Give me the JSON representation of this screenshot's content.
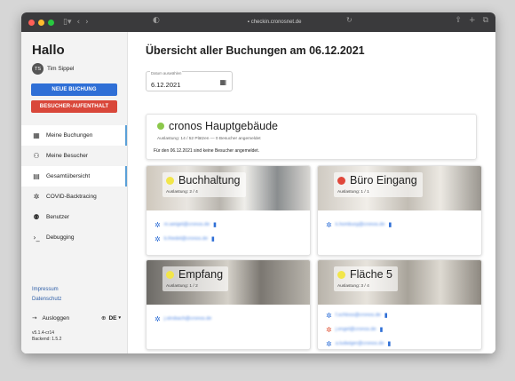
{
  "browser": {
    "url": "checkin.cronosnet.de",
    "traffic_colors": [
      "#ff5f57",
      "#febc2e",
      "#28c840"
    ]
  },
  "sidebar": {
    "greeting": "Hallo",
    "user": {
      "initials": "TS",
      "name": "Tim Sippel"
    },
    "new_booking": "NEUE BUCHUNG",
    "visitor_stay": "BESUCHER-AUFENTHALT",
    "items": [
      {
        "label": "Meine Buchungen",
        "icon": "calendar-icon",
        "active": true
      },
      {
        "label": "Meine Besucher",
        "icon": "visitors-icon",
        "active": false
      },
      {
        "label": "Gesamtübersicht",
        "icon": "overview-icon",
        "active": true
      },
      {
        "label": "COVID-Backtracing",
        "icon": "virus-icon",
        "active": false
      },
      {
        "label": "Benutzer",
        "icon": "users-icon",
        "active": false
      },
      {
        "label": "Debugging",
        "icon": "terminal-icon",
        "active": false
      }
    ],
    "impressum": "Impressum",
    "datenschutz": "Datenschutz",
    "logout": "Ausloggen",
    "language": "DE",
    "version": "v5.1.4-cr14",
    "backend": "Backend: 1.5.2"
  },
  "main": {
    "title": "Übersicht aller Buchungen am 06.12.2021",
    "date_label": "Datum auswählen",
    "date_value": "6.12.2021",
    "location": {
      "name": "cronos Hauptgebäude",
      "status_color": "#8cc84b",
      "utilization": "Auslastung: 14 / 52 Plätzen — 0 Besucher angemeldet",
      "info": "Für den 06.12.2021 sind keine Besucher angemeldet."
    },
    "rooms": [
      {
        "name": "Buchhaltung",
        "utilization": "Auslastung: 2 / 4",
        "status_color": "#f2e64a",
        "people": [
          {
            "email": "m.weigel@cronos.de",
            "icon": "virus-icon"
          },
          {
            "email": "b.friedel@cronos.de",
            "icon": "virus-icon"
          }
        ]
      },
      {
        "name": "Büro Eingang",
        "utilization": "Auslastung: 1 / 1",
        "status_color": "#e0473a",
        "people": [
          {
            "email": "k.homburg@cronos.de",
            "icon": "virus-icon"
          }
        ]
      },
      {
        "name": "Empfang",
        "utilization": "Auslastung: 1 / 2",
        "status_color": "#f2e64a",
        "people": [
          {
            "email": "j.strobach@cronos.de",
            "icon": "virus-icon"
          }
        ]
      },
      {
        "name": "Fläche 5",
        "utilization": "Auslastung: 3 / 4",
        "status_color": "#f2e64a",
        "people": [
          {
            "email": "f.schloss@cronos.de",
            "icon": "virus-icon"
          },
          {
            "email": "j.engel@cronos.de",
            "icon": "virus-red-icon"
          },
          {
            "email": "a.ludwiger@cronos.de",
            "icon": "virus-icon"
          }
        ]
      }
    ]
  }
}
